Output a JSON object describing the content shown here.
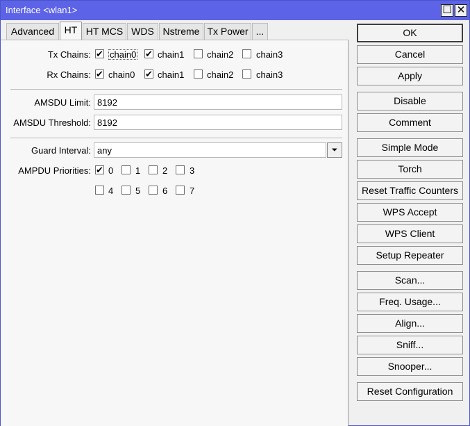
{
  "window": {
    "title": "Interface <wlan1>",
    "restore_glyph": "☐",
    "close_glyph": "✕"
  },
  "tabs": [
    "Advanced",
    "HT",
    "HT MCS",
    "WDS",
    "Nstreme",
    "Tx Power",
    "..."
  ],
  "active_tab": "HT",
  "tx_chains": {
    "label": "Tx Chains:",
    "options": [
      {
        "label": "chain0",
        "checked": true
      },
      {
        "label": "chain1",
        "checked": true
      },
      {
        "label": "chain2",
        "checked": false
      },
      {
        "label": "chain3",
        "checked": false
      }
    ]
  },
  "rx_chains": {
    "label": "Rx Chains:",
    "options": [
      {
        "label": "chain0",
        "checked": true
      },
      {
        "label": "chain1",
        "checked": true
      },
      {
        "label": "chain2",
        "checked": false
      },
      {
        "label": "chain3",
        "checked": false
      }
    ]
  },
  "amsdu_limit": {
    "label": "AMSDU Limit:",
    "value": "8192"
  },
  "amsdu_threshold": {
    "label": "AMSDU Threshold:",
    "value": "8192"
  },
  "guard_interval": {
    "label": "Guard Interval:",
    "value": "any",
    "dropdown_glyph": "⏷"
  },
  "ampdu_priorities": {
    "label": "AMPDU Priorities:",
    "options": [
      {
        "label": "0",
        "checked": true
      },
      {
        "label": "1",
        "checked": false
      },
      {
        "label": "2",
        "checked": false
      },
      {
        "label": "3",
        "checked": false
      },
      {
        "label": "4",
        "checked": false
      },
      {
        "label": "5",
        "checked": false
      },
      {
        "label": "6",
        "checked": false
      },
      {
        "label": "7",
        "checked": false
      }
    ]
  },
  "checkmark_glyph": "✔",
  "buttons": {
    "ok": "OK",
    "cancel": "Cancel",
    "apply": "Apply",
    "disable": "Disable",
    "comment": "Comment",
    "simple_mode": "Simple Mode",
    "torch": "Torch",
    "reset_traffic_counters": "Reset Traffic Counters",
    "wps_accept": "WPS Accept",
    "wps_client": "WPS Client",
    "setup_repeater": "Setup Repeater",
    "scan": "Scan...",
    "freq_usage": "Freq. Usage...",
    "align": "Align...",
    "sniff": "Sniff...",
    "snooper": "Snooper...",
    "reset_configuration": "Reset Configuration"
  }
}
